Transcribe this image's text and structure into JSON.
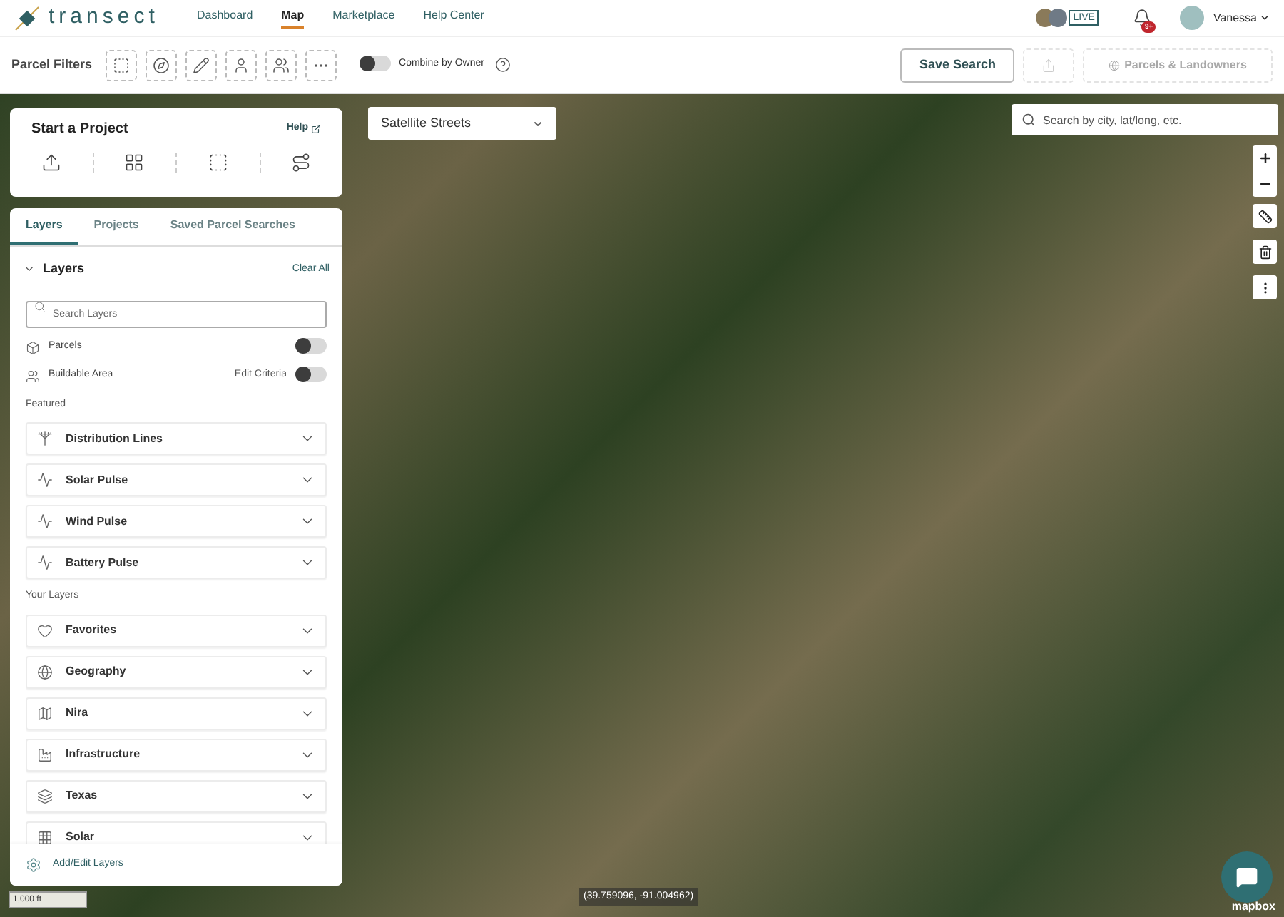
{
  "nav": {
    "logo": "transect",
    "links": [
      {
        "label": "Dashboard",
        "selected": false
      },
      {
        "label": "Map",
        "selected": true
      },
      {
        "label": "Marketplace",
        "selected": false
      },
      {
        "label": "Help Center",
        "selected": false
      }
    ],
    "live": "LIVE",
    "notification_count": "9+",
    "user": "Vanessa"
  },
  "filter_bar": {
    "label": "Parcel Filters",
    "combine": {
      "label": "Combine by Owner",
      "on": false
    },
    "save": "Save Search",
    "export_disabled": true,
    "parcels_button": {
      "label": "Parcels & Landowners",
      "disabled": true
    }
  },
  "start_project": {
    "title": "Start a Project",
    "help": "Help"
  },
  "tabs": [
    {
      "label": "Layers",
      "selected": true
    },
    {
      "label": "Projects",
      "selected": false
    },
    {
      "label": "Saved Parcel Searches",
      "selected": false
    }
  ],
  "layers": {
    "title": "Layers",
    "expanded": true,
    "clear": "Clear All",
    "search_placeholder": "Search Layers",
    "toggles": [
      {
        "label": "Parcels",
        "on": false
      },
      {
        "label": "Buildable Area",
        "action": "Edit Criteria",
        "on": false
      }
    ],
    "featured_heading": "Featured",
    "featured": [
      {
        "label": "Distribution Lines",
        "expanded": false
      },
      {
        "label": "Solar Pulse",
        "expanded": false
      },
      {
        "label": "Wind Pulse",
        "expanded": false
      },
      {
        "label": "Battery Pulse",
        "expanded": false
      }
    ],
    "your_heading": "Your Layers",
    "yours": [
      {
        "label": "Favorites",
        "expanded": false
      },
      {
        "label": "Geography",
        "expanded": false
      },
      {
        "label": "Nira",
        "expanded": false
      },
      {
        "label": "Infrastructure",
        "expanded": false
      },
      {
        "label": "Texas",
        "expanded": false
      },
      {
        "label": "Solar",
        "expanded": false
      }
    ],
    "footer": "Add/Edit Layers"
  },
  "map": {
    "basemap": "Satellite Streets",
    "search_placeholder": "Search by city, lat/long, etc.",
    "coordinates": "(39.759096, -91.004962)",
    "scale": "1,000 ft",
    "attribution": "mapbox"
  }
}
